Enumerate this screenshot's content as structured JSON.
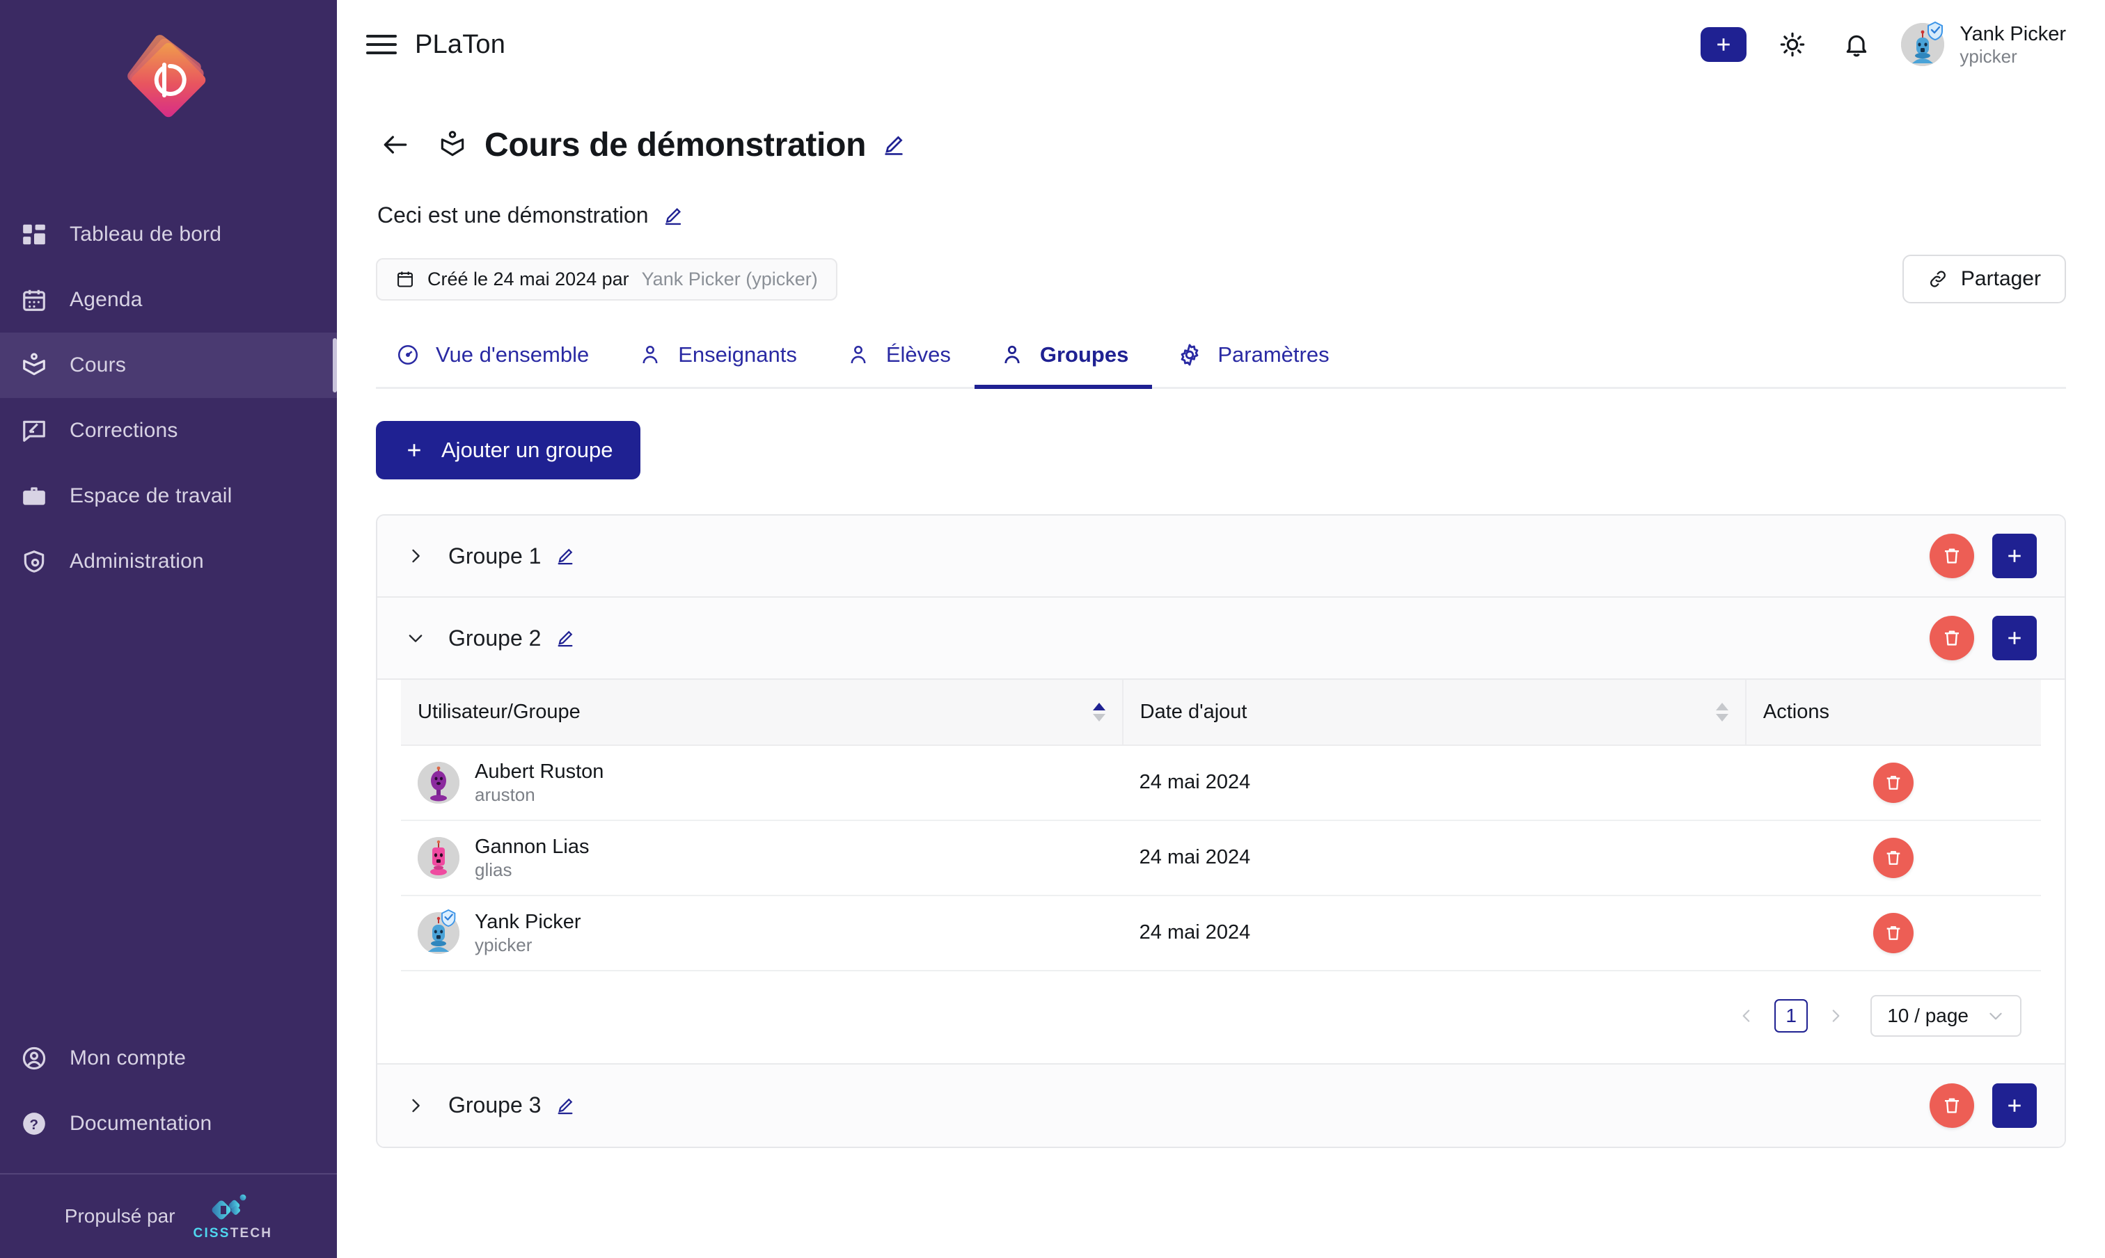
{
  "sidebar": {
    "logo_name": "platon-logo",
    "items_top": [
      {
        "label": "Tableau de bord",
        "icon": "dashboard-icon",
        "active": false
      },
      {
        "label": "Agenda",
        "icon": "calendar-icon",
        "active": false
      },
      {
        "label": "Cours",
        "icon": "course-book-icon",
        "active": true
      },
      {
        "label": "Corrections",
        "icon": "comment-edit-icon",
        "active": false
      },
      {
        "label": "Espace de travail",
        "icon": "briefcase-icon",
        "active": false
      },
      {
        "label": "Administration",
        "icon": "shield-user-icon",
        "active": false
      }
    ],
    "items_bottom": [
      {
        "label": "Mon compte",
        "icon": "account-circle-icon",
        "active": false
      },
      {
        "label": "Documentation",
        "icon": "help-circle-icon",
        "active": false
      }
    ],
    "powered_by": "Propulsé par",
    "vendor_a": "CISS",
    "vendor_b": "TECH"
  },
  "topbar": {
    "brand": "PLaTon",
    "menu_icon": "hamburger-icon",
    "add_icon": "plus-icon",
    "theme_icon": "sun-icon",
    "notifications_icon": "bell-icon",
    "user_name": "Yank Picker",
    "user_handle": "ypicker"
  },
  "page": {
    "back_icon": "arrow-left-icon",
    "course_icon": "course-book-icon",
    "title": "Cours de démonstration",
    "edit_icon": "pencil-icon",
    "subtitle": "Ceci est une démonstration",
    "meta_icon": "calendar-icon",
    "meta_text": "Créé le 24 mai 2024 par",
    "meta_author": "Yank Picker (ypicker)",
    "share_icon": "link-icon",
    "share_label": "Partager"
  },
  "tabs": [
    {
      "label": "Vue d'ensemble",
      "icon": "gauge-icon",
      "active": false
    },
    {
      "label": "Enseignants",
      "icon": "person-icon",
      "active": false
    },
    {
      "label": "Élèves",
      "icon": "person-icon",
      "active": false
    },
    {
      "label": "Groupes",
      "icon": "person-icon",
      "active": true
    },
    {
      "label": "Paramètres",
      "icon": "gear-icon",
      "active": false
    }
  ],
  "actions": {
    "add_group_label": "Ajouter un groupe",
    "add_group_icon": "plus-icon",
    "delete_icon": "trash-icon",
    "add_member_icon": "plus-icon"
  },
  "groups": [
    {
      "name": "Groupe 1",
      "expanded": false,
      "chevron": "chevron-right-icon"
    },
    {
      "name": "Groupe 2",
      "expanded": true,
      "chevron": "chevron-down-icon"
    },
    {
      "name": "Groupe 3",
      "expanded": false,
      "chevron": "chevron-right-icon"
    }
  ],
  "members_table": {
    "headers": {
      "user": "Utilisateur/Groupe",
      "date": "Date d'ajout",
      "actions": "Actions"
    },
    "sort": {
      "column": "user",
      "direction": "asc"
    },
    "rows": [
      {
        "name": "Aubert Ruston",
        "handle": "aruston",
        "date": "24 mai 2024",
        "avatar": "avatar-purple-robot",
        "verified": false
      },
      {
        "name": "Gannon Lias",
        "handle": "glias",
        "date": "24 mai 2024",
        "avatar": "avatar-pink-robot",
        "verified": false
      },
      {
        "name": "Yank Picker",
        "handle": "ypicker",
        "date": "24 mai 2024",
        "avatar": "avatar-blue-robot",
        "verified": true
      }
    ]
  },
  "pagination": {
    "prev_icon": "chevron-left-icon",
    "next_icon": "chevron-right-icon",
    "current_page": "1",
    "page_size": "10 / page",
    "dropdown_icon": "chevron-down-icon"
  },
  "colors": {
    "sidebar_bg": "#3b2a63",
    "sidebar_active": "#4a3a71",
    "primary": "#1f2192",
    "danger": "#ed5e55",
    "muted_text": "#7c8087"
  }
}
